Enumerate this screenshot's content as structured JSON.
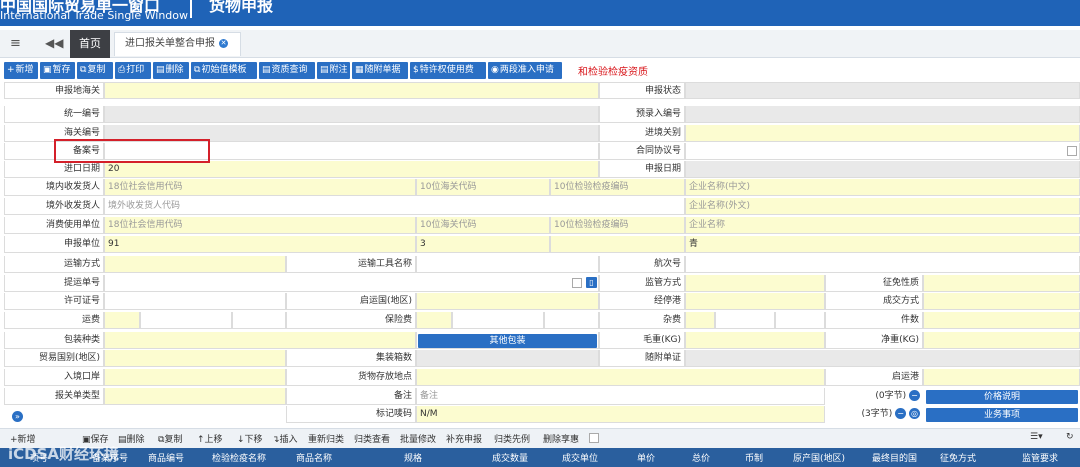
{
  "header": {
    "brand_cn": "中国国际贸易单一窗口",
    "brand_en": "International Trade Single Window",
    "title": "货物申报"
  },
  "tabs": {
    "home": "首页",
    "active": "进口报关单整合申报"
  },
  "toolbar": {
    "buttons": [
      "新增",
      "暂存",
      "复制",
      "打印",
      "删除",
      "初始值模板",
      "资质查询",
      "附注",
      "随附单据",
      "特许权使用费",
      "两段准入申请"
    ],
    "red_text": "和检验检疫资质"
  },
  "form": {
    "labels": {
      "declare_customs": "申报地海关",
      "declare_status": "申报状态",
      "unified_no": "统一编号",
      "pre_entry_no": "预录入编号",
      "customs_no": "海关编号",
      "ie_customs": "进境关别",
      "record_no": "备案号",
      "contract_no": "合同协议号",
      "import_date": "进口日期",
      "declare_date": "申报日期",
      "domestic_consignee": "境内收发货人",
      "foreign_consignee": "境外收发货人",
      "consumer_unit": "消费使用单位",
      "declare_unit": "申报单位",
      "transport_mode": "运输方式",
      "transport_name": "运输工具名称",
      "voyage_no": "航次号",
      "bill_no": "提运单号",
      "supervision": "监管方式",
      "tax_nature": "征免性质",
      "license_no": "许可证号",
      "departure_country": "启运国(地区)",
      "stop_port": "经停港",
      "trade_terms": "成交方式",
      "freight": "运费",
      "insurance": "保险费",
      "misc_fee": "杂费",
      "pieces": "件数",
      "package_type": "包装种类",
      "gross_weight": "毛重(KG)",
      "net_weight": "净重(KG)",
      "trade_country": "贸易国别(地区)",
      "container_count": "集装箱数",
      "attached_docs": "随附单证",
      "entry_port": "入境口岸",
      "storage_place": "货物存放地点",
      "departure_port": "启运港",
      "declaration_type": "报关单类型",
      "remarks": "备注",
      "marks": "标记唛码"
    },
    "placeholders": {
      "credit_code": "18位社会信用代码",
      "customs_code": "10位海关代码",
      "inspection_code": "10位检验检疫编码",
      "company_cn": "企业名称(中文)",
      "foreign_code": "境外收发货人代码",
      "company_en": "企业名称(外文)",
      "company": "企业名称",
      "remarks": "备注"
    },
    "values": {
      "import_date": "20",
      "declare_unit_code": "91",
      "declare_unit_customs": "3",
      "declare_unit_name": "青",
      "marks": "N/M"
    },
    "other_package_btn": "其他包装",
    "remarks_bytes": "(0字节)",
    "marks_bytes": "(3字节)",
    "price_note_btn": "价格说明",
    "business_btn": "业务事项"
  },
  "bottombar": {
    "items": [
      "新增",
      "保存",
      "删除",
      "复制",
      "上移",
      "下移",
      "插入",
      "重新归类",
      "归类查看",
      "批量修改",
      "补充申报",
      "归类先例",
      "删除享惠"
    ]
  },
  "table": {
    "headers": [
      "项号",
      "备案序号",
      "商品编号",
      "检验检疫名称",
      "商品名称",
      "规格",
      "成交数量",
      "成交单位",
      "单价",
      "总价",
      "币制",
      "原产国(地区)",
      "最终目的国",
      "征免方式",
      "监管要求"
    ]
  },
  "watermark": "iCDSA财经环境"
}
